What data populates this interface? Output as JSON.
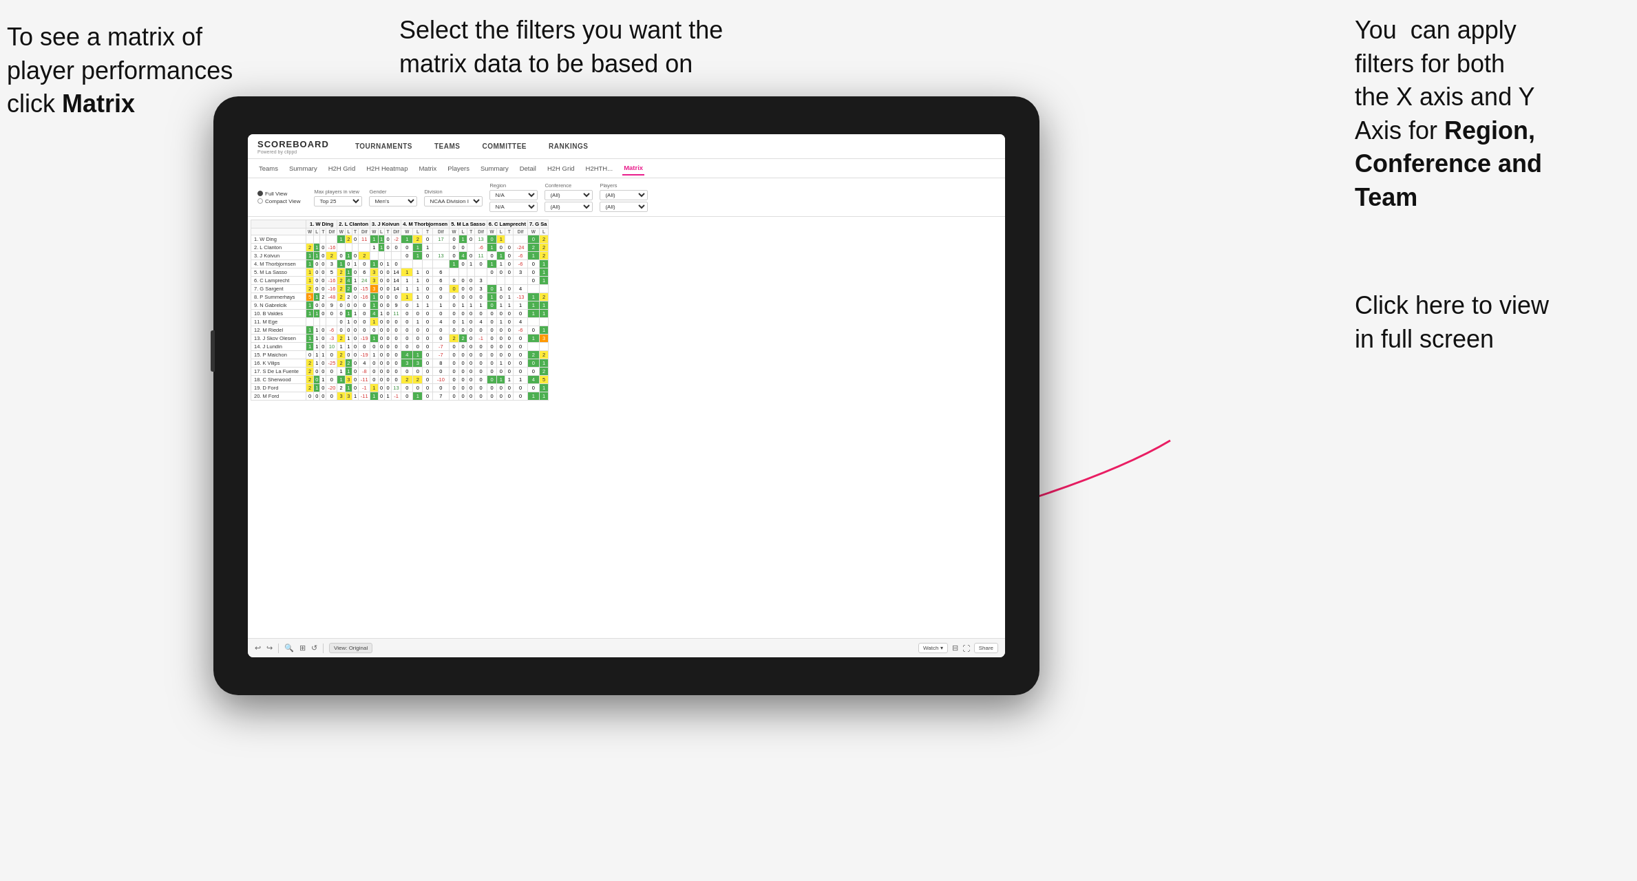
{
  "annotations": {
    "left": {
      "line1": "To see a matrix of",
      "line2": "player performances",
      "line3_prefix": "click ",
      "line3_bold": "Matrix"
    },
    "center": {
      "text": "Select the filters you want the matrix data to be based on"
    },
    "right": {
      "line1": "You  can apply",
      "line2": "filters for both",
      "line3": "the X axis and Y",
      "line4_prefix": "Axis for ",
      "line4_bold": "Region,",
      "line5_bold": "Conference and",
      "line6_bold": "Team"
    },
    "bottom_right": {
      "line1": "Click here to view",
      "line2": "in full screen"
    }
  },
  "app": {
    "logo": "SCOREBOARD",
    "logo_sub": "Powered by clippd",
    "nav_items": [
      "TOURNAMENTS",
      "TEAMS",
      "COMMITTEE",
      "RANKINGS"
    ],
    "sub_nav": [
      "Teams",
      "Summary",
      "H2H Grid",
      "H2H Heatmap",
      "Matrix",
      "Players",
      "Summary",
      "Detail",
      "H2H Grid",
      "H2HTH...",
      "Matrix"
    ],
    "active_sub_nav": "Matrix",
    "view_options": [
      "Full View",
      "Compact View"
    ],
    "selected_view": "Full View",
    "filters": [
      {
        "label": "Max players in view",
        "value": "Top 25"
      },
      {
        "label": "Gender",
        "value": "Men's"
      },
      {
        "label": "Division",
        "value": "NCAA Division I"
      },
      {
        "label": "Region",
        "value1": "N/A",
        "value2": "N/A"
      },
      {
        "label": "Conference",
        "value1": "(All)",
        "value2": "(All)"
      },
      {
        "label": "Players",
        "value1": "(All)",
        "value2": "(All)"
      }
    ],
    "column_headers": [
      "1. W Ding",
      "2. L Clanton",
      "3. J Koivun",
      "4. M Thorbjornsen",
      "5. M La Sasso",
      "6. C Lamprecht",
      "7. G Sa"
    ],
    "col_sub": [
      "W",
      "L",
      "T",
      "Dif"
    ],
    "rows": [
      {
        "name": "1. W Ding",
        "cells": [
          {
            "type": "white"
          },
          {
            "g": 1,
            "y": 2,
            "w": 0,
            "n": 11
          },
          {
            "g": 1,
            "y": 1,
            "w": 0,
            "n": -2
          },
          {
            "g": 1,
            "y": 2,
            "w": 0,
            "n": 17
          },
          {
            "w": 0,
            "g": 1,
            "w2": 0,
            "n": 13
          },
          {
            "g": 0,
            "y": 2
          }
        ]
      },
      {
        "name": "2. L Clanton",
        "cells": [
          {
            "g": 2,
            "y": 1,
            "w": 0,
            "n": -16
          },
          {
            "white": true
          },
          {
            "w": 1,
            "g": 1,
            "w2": 0,
            "n": 0
          },
          {
            "w": 0,
            "g": 1,
            "w2": 1
          },
          {
            "w": 0,
            "g": 0,
            "n": -6
          },
          {
            "g": 1,
            "w": 0,
            "y": 0,
            "n": -24
          },
          {
            "g": 2,
            "w": 2
          }
        ]
      },
      {
        "name": "3. J Koivun",
        "cells": []
      },
      {
        "name": "4. M Thorbjornsen",
        "cells": []
      },
      {
        "name": "5. M La Sasso",
        "cells": []
      },
      {
        "name": "6. C Lamprecht",
        "cells": []
      },
      {
        "name": "7. G Sargent",
        "cells": []
      },
      {
        "name": "8. P Summerhays",
        "cells": []
      },
      {
        "name": "9. N Gabrelcik",
        "cells": []
      },
      {
        "name": "10. B Valdes",
        "cells": []
      },
      {
        "name": "11. M Ege",
        "cells": []
      },
      {
        "name": "12. M Riedel",
        "cells": []
      },
      {
        "name": "13. J Skov Olesen",
        "cells": []
      },
      {
        "name": "14. J Lundin",
        "cells": []
      },
      {
        "name": "15. P Maichon",
        "cells": []
      },
      {
        "name": "16. K Vilips",
        "cells": []
      },
      {
        "name": "17. S De La Fuente",
        "cells": []
      },
      {
        "name": "18. C Sherwood",
        "cells": []
      },
      {
        "name": "19. D Ford",
        "cells": []
      },
      {
        "name": "20. M Ford",
        "cells": []
      }
    ],
    "toolbar": {
      "view_label": "View: Original",
      "watch_label": "Watch ▾",
      "share_label": "Share"
    }
  }
}
